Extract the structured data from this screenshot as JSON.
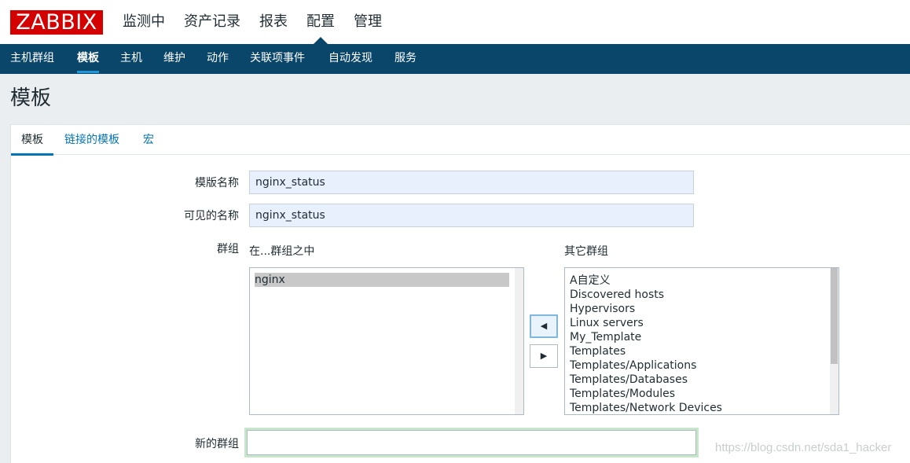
{
  "logo": {
    "text": "ZABBIX"
  },
  "topmenu": {
    "items": [
      {
        "label": "监测中"
      },
      {
        "label": "资产记录"
      },
      {
        "label": "报表"
      },
      {
        "label": "配置"
      },
      {
        "label": "管理"
      }
    ],
    "active": "配置"
  },
  "subnav": {
    "items": [
      {
        "label": "主机群组"
      },
      {
        "label": "模板"
      },
      {
        "label": "主机"
      },
      {
        "label": "维护"
      },
      {
        "label": "动作"
      },
      {
        "label": "关联项事件"
      },
      {
        "label": "自动发现"
      },
      {
        "label": "服务"
      }
    ],
    "active": "模板"
  },
  "page": {
    "title": "模板"
  },
  "tabs": [
    {
      "label": "模板"
    },
    {
      "label": "链接的模板"
    },
    {
      "label": "宏"
    }
  ],
  "form": {
    "template_name_label": "模版名称",
    "template_name_value": "nginx_status",
    "visible_name_label": "可见的名称",
    "visible_name_value": "nginx_status",
    "groups_label": "群组",
    "in_groups_label": "在...群组之中",
    "other_groups_label": "其它群组",
    "in_groups": [
      "nginx"
    ],
    "other_groups": [
      "A自定义",
      "Discovered hosts",
      "Hypervisors",
      "Linux servers",
      "My_Template",
      "Templates",
      "Templates/Applications",
      "Templates/Databases",
      "Templates/Modules",
      "Templates/Network Devices"
    ],
    "move_left_icon": "◀",
    "move_right_icon": "▶",
    "new_group_label": "新的群组",
    "new_group_value": ""
  },
  "watermark": "https://blog.csdn.net/sda1_hacker",
  "colors": {
    "brand_red": "#d40000",
    "nav_blue": "#0a466a",
    "link_blue": "#0275b8",
    "accent": "#1f96d9"
  }
}
